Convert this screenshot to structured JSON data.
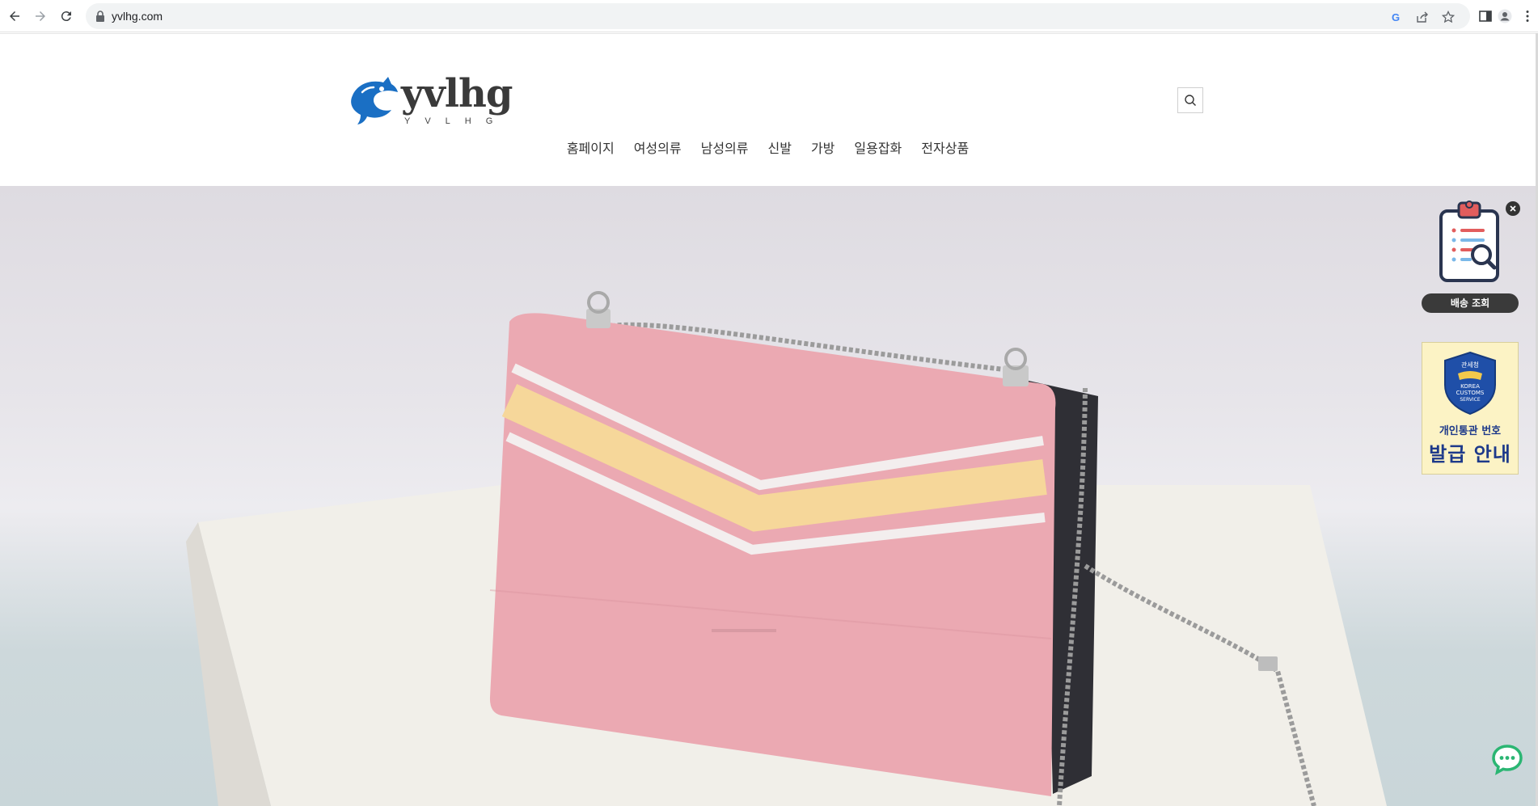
{
  "browser": {
    "url": "yvlhg.com"
  },
  "site": {
    "logo_text": "yvlhg",
    "logo_subtext": "YVLHG",
    "nav": [
      {
        "label": "홈페이지"
      },
      {
        "label": "여성의류"
      },
      {
        "label": "남성의류"
      },
      {
        "label": "신발"
      },
      {
        "label": "가방"
      },
      {
        "label": "일용잡화"
      },
      {
        "label": "전자상품"
      }
    ]
  },
  "widgets": {
    "delivery_label": "배송 조회",
    "customs_agency": "관세청",
    "customs_badge": "KOREA CUSTOMS SERVICE",
    "customs_line1": "개인통관 번호",
    "customs_line2": "발급 안내"
  },
  "colors": {
    "accent_blue": "#1a6fc4",
    "chat_green": "#2bb673",
    "bag_pink": "#eba9b2",
    "stripe_yellow": "#f6d79a"
  }
}
